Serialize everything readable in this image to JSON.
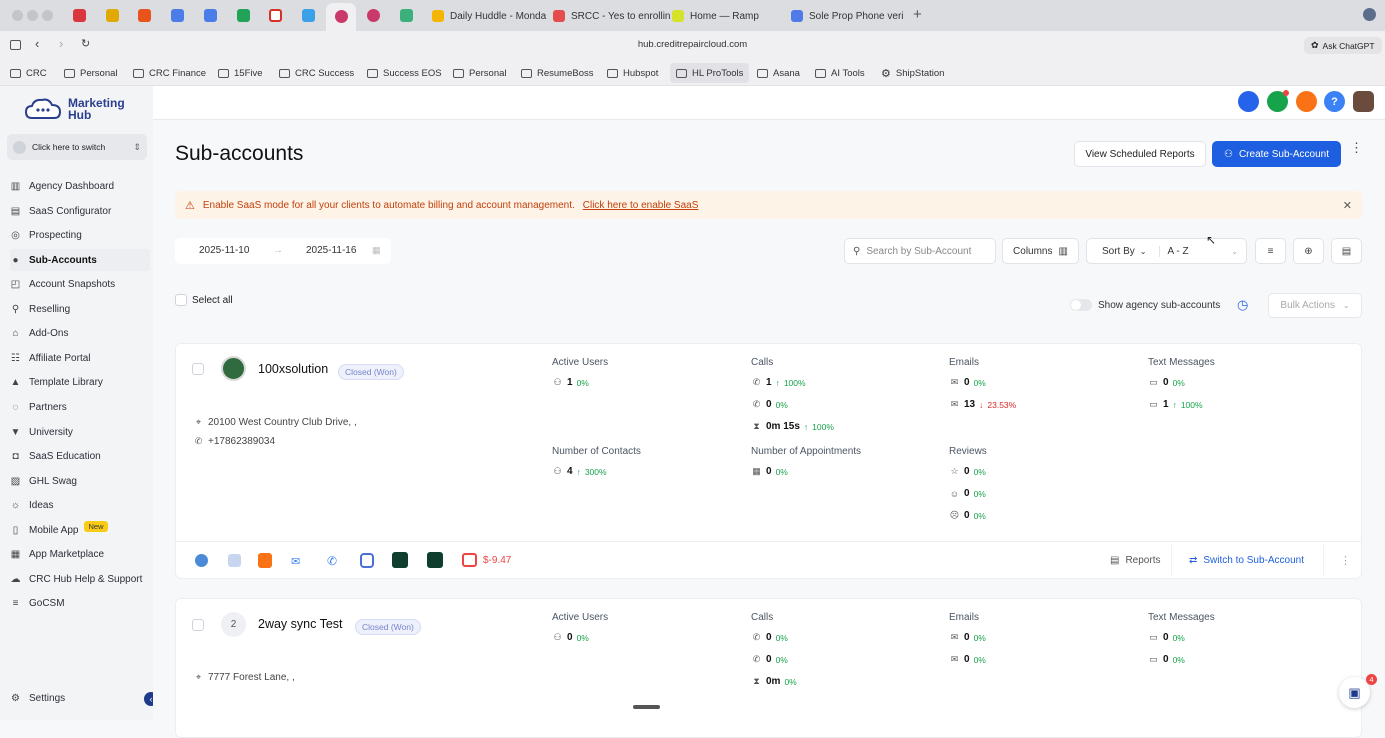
{
  "browser": {
    "tabs": [
      {
        "label": "Daily Huddle - Monda",
        "color": "#f5b400"
      },
      {
        "label": "SRCC - Yes to enrollin",
        "color": "#e44d4d"
      },
      {
        "label": "Home — Ramp",
        "color": "#d6e32a"
      },
      {
        "label": "Sole Prop Phone veri",
        "color": "#4f7ae8"
      }
    ],
    "new_tab": "+",
    "url": "hub.creditrepaircloud.com",
    "ask_chatgpt": "Ask ChatGPT",
    "bookmarks": [
      "CRC",
      "Personal",
      "CRC Finance",
      "15Five",
      "CRC Success",
      "Success EOS",
      "Personal",
      "ResumeBoss",
      "Hubspot",
      "HL ProTools",
      "Asana",
      "AI Tools",
      "ShipStation"
    ]
  },
  "sidebar": {
    "logo_line1": "Marketing",
    "logo_line2": "Hub",
    "switcher": "Click here to switch",
    "items": [
      {
        "label": "Agency Dashboard",
        "icon": "dashboard-icon",
        "glyph": "▥"
      },
      {
        "label": "SaaS Configurator",
        "icon": "chart-icon",
        "glyph": "▤"
      },
      {
        "label": "Prospecting",
        "icon": "prospecting-icon",
        "glyph": "◎"
      },
      {
        "label": "Sub-Accounts",
        "icon": "user-icon",
        "glyph": "●"
      },
      {
        "label": "Account Snapshots",
        "icon": "snapshot-icon",
        "glyph": "◰"
      },
      {
        "label": "Reselling",
        "icon": "reselling-icon",
        "glyph": "⚲"
      },
      {
        "label": "Add-Ons",
        "icon": "lock-icon",
        "glyph": "⌂"
      },
      {
        "label": "Affiliate Portal",
        "icon": "users-icon",
        "glyph": "☷"
      },
      {
        "label": "Template Library",
        "icon": "library-icon",
        "glyph": "▲"
      },
      {
        "label": "Partners",
        "icon": "partners-icon",
        "glyph": "◌"
      },
      {
        "label": "University",
        "icon": "graduation-icon",
        "glyph": "▼"
      },
      {
        "label": "SaaS Education",
        "icon": "education-icon",
        "glyph": "◘"
      },
      {
        "label": "GHL Swag",
        "icon": "swag-icon",
        "glyph": "▨"
      },
      {
        "label": "Ideas",
        "icon": "lightbulb-icon",
        "glyph": "☼"
      },
      {
        "label": "Mobile App",
        "icon": "mobile-icon",
        "glyph": "▯",
        "badge": "New"
      },
      {
        "label": "App Marketplace",
        "icon": "grid-icon",
        "glyph": "▦"
      },
      {
        "label": "CRC Hub Help & Support",
        "icon": "support-icon",
        "glyph": "☁"
      },
      {
        "label": "GoCSM",
        "icon": "menu-icon",
        "glyph": "≡"
      }
    ],
    "settings": "Settings"
  },
  "header": {
    "title": "Sub-accounts",
    "view_reports": "View Scheduled Reports",
    "create": "Create Sub-Account"
  },
  "banner": {
    "text": "Enable SaaS mode for all your clients to automate billing and account management.",
    "link": "Click here to enable SaaS"
  },
  "filters": {
    "date_from": "2025-11-10",
    "date_to": "2025-11-16",
    "search_placeholder": "Search by Sub-Account",
    "columns": "Columns",
    "sort_by": "Sort By",
    "sort_value": "A - Z",
    "select_all": "Select all",
    "show_agency": "Show agency sub-accounts",
    "bulk_actions": "Bulk Actions"
  },
  "accounts": [
    {
      "name": "100xsolution",
      "status": "Closed (Won)",
      "address": "20100 West Country Club Drive, ,",
      "phone": "+17862389034",
      "active_users_label": "Active Users",
      "active_users": "1",
      "active_users_pct": "0%",
      "calls_label": "Calls",
      "calls_in": "1",
      "calls_in_pct": "100%",
      "calls_out": "0",
      "calls_out_pct": "0%",
      "call_time": "0m 15s",
      "call_time_pct": "100%",
      "emails_label": "Emails",
      "emails_in": "0",
      "emails_in_pct": "0%",
      "emails_out": "13",
      "emails_out_pct": "23.53%",
      "texts_label": "Text Messages",
      "texts_in": "0",
      "texts_in_pct": "0%",
      "texts_out": "1",
      "texts_out_pct": "100%",
      "contacts_label": "Number of Contacts",
      "contacts": "4",
      "contacts_pct": "300%",
      "appointments_label": "Number of Appointments",
      "appointments": "0",
      "appointments_pct": "0%",
      "reviews_label": "Reviews",
      "reviews_1": "0",
      "reviews_1_pct": "0%",
      "reviews_2": "0",
      "reviews_2_pct": "0%",
      "reviews_3": "0",
      "reviews_3_pct": "0%",
      "wallet": "$-9.47",
      "reports": "Reports",
      "switch": "Switch to Sub-Account"
    },
    {
      "avatar": "2",
      "name": "2way sync Test",
      "status": "Closed (Won)",
      "address": "7777 Forest Lane, ,",
      "active_users_label": "Active Users",
      "active_users": "0",
      "active_users_pct": "0%",
      "calls_label": "Calls",
      "calls_in": "0",
      "calls_in_pct": "0%",
      "calls_out": "0",
      "calls_out_pct": "0%",
      "call_time": "0m",
      "call_time_pct": "0%",
      "emails_label": "Emails",
      "emails_in": "0",
      "emails_in_pct": "0%",
      "emails_out": "0",
      "emails_out_pct": "0%",
      "texts_label": "Text Messages",
      "texts_in": "0",
      "texts_in_pct": "0%",
      "texts_out": "0",
      "texts_out_pct": "0%"
    }
  ],
  "chat_badge": "4",
  "colors": {
    "primary": "#1d5fe0",
    "banner_bg": "#fdf3e7",
    "banner_text": "#c2410c",
    "green": "#16a34a",
    "red": "#dc2626"
  }
}
